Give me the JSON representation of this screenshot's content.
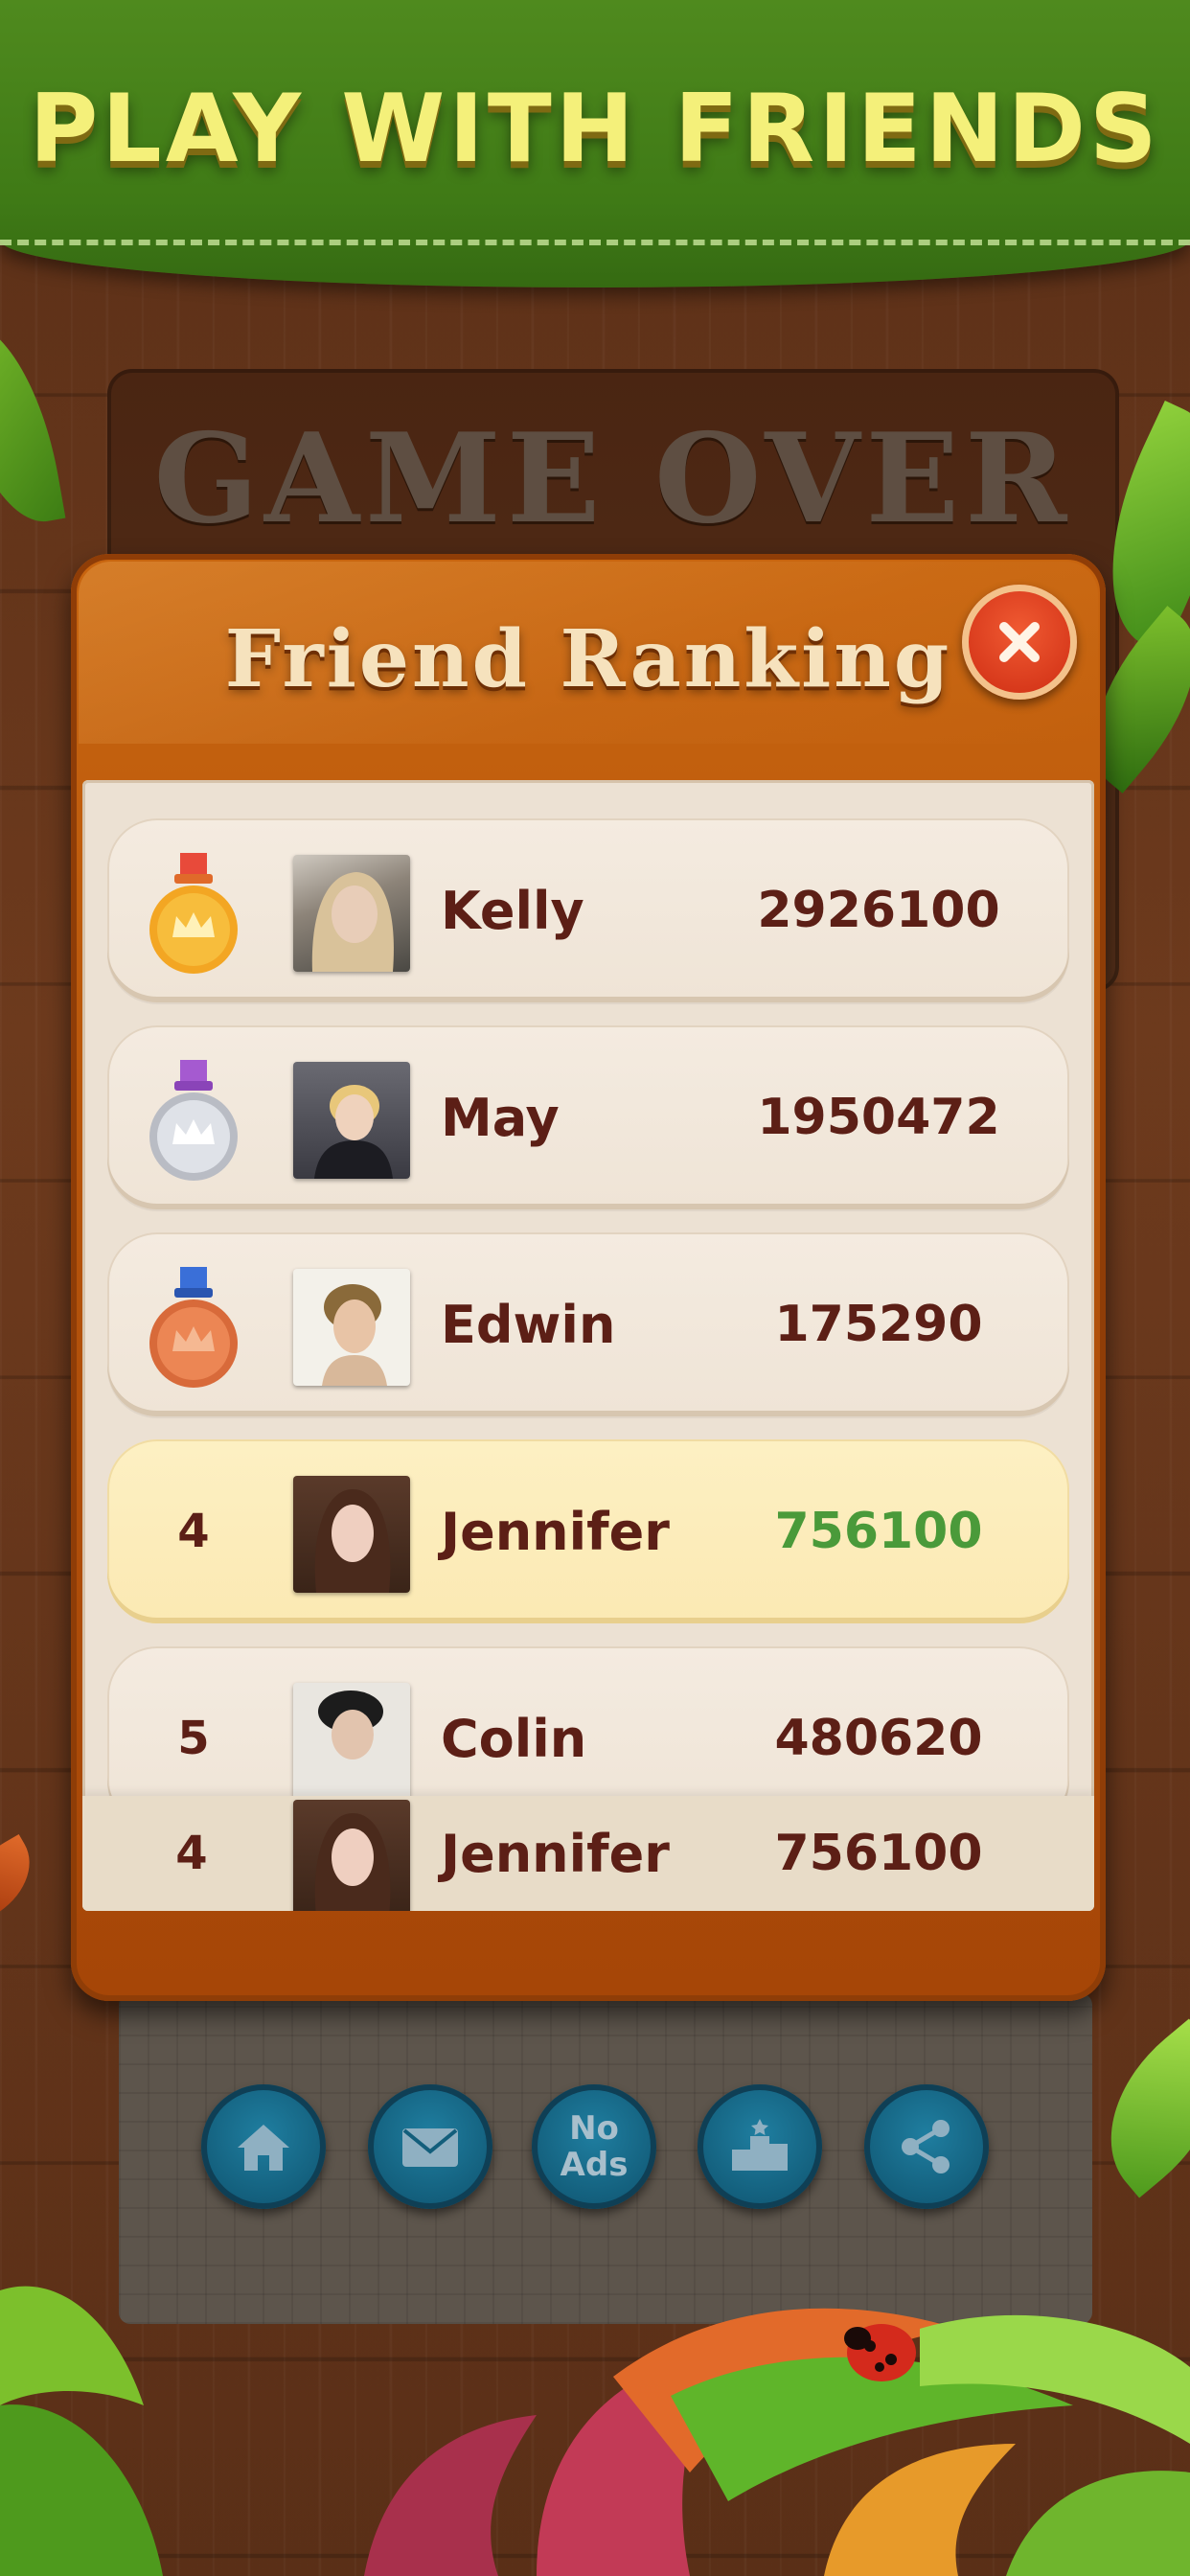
{
  "banner": {
    "title": "PLAY WITH FRIENDS"
  },
  "game_over": {
    "title": "GAME OVER"
  },
  "modal": {
    "title": "Friend Ranking",
    "close_icon": "close-icon"
  },
  "ranking": [
    {
      "rank": "1",
      "name": "Kelly",
      "score": "2926100",
      "medal": "gold-medal-icon"
    },
    {
      "rank": "2",
      "name": "May",
      "score": "1950472",
      "medal": "silver-medal-icon"
    },
    {
      "rank": "3",
      "name": "Edwin",
      "score": "175290",
      "medal": "bronze-medal-icon"
    },
    {
      "rank": "4",
      "name": "Jennifer",
      "score": "756100",
      "highlight": true
    },
    {
      "rank": "5",
      "name": "Colin",
      "score": "480620"
    }
  ],
  "my_rank": {
    "rank": "4",
    "name": "Jennifer",
    "score": "756100"
  },
  "bottom_buttons": [
    {
      "icon": "home-icon"
    },
    {
      "icon": "mail-icon"
    },
    {
      "label": "No\nAds"
    },
    {
      "icon": "podium-icon"
    },
    {
      "icon": "share-icon"
    }
  ],
  "colors": {
    "banner_green": "#3f7a16",
    "banner_text": "#f4f07a",
    "modal_orange": "#c8650f",
    "name_brown": "#5c1f16",
    "my_score_green": "#4a9a3a",
    "button_blue": "#135e7b",
    "close_red": "#d6371a"
  }
}
